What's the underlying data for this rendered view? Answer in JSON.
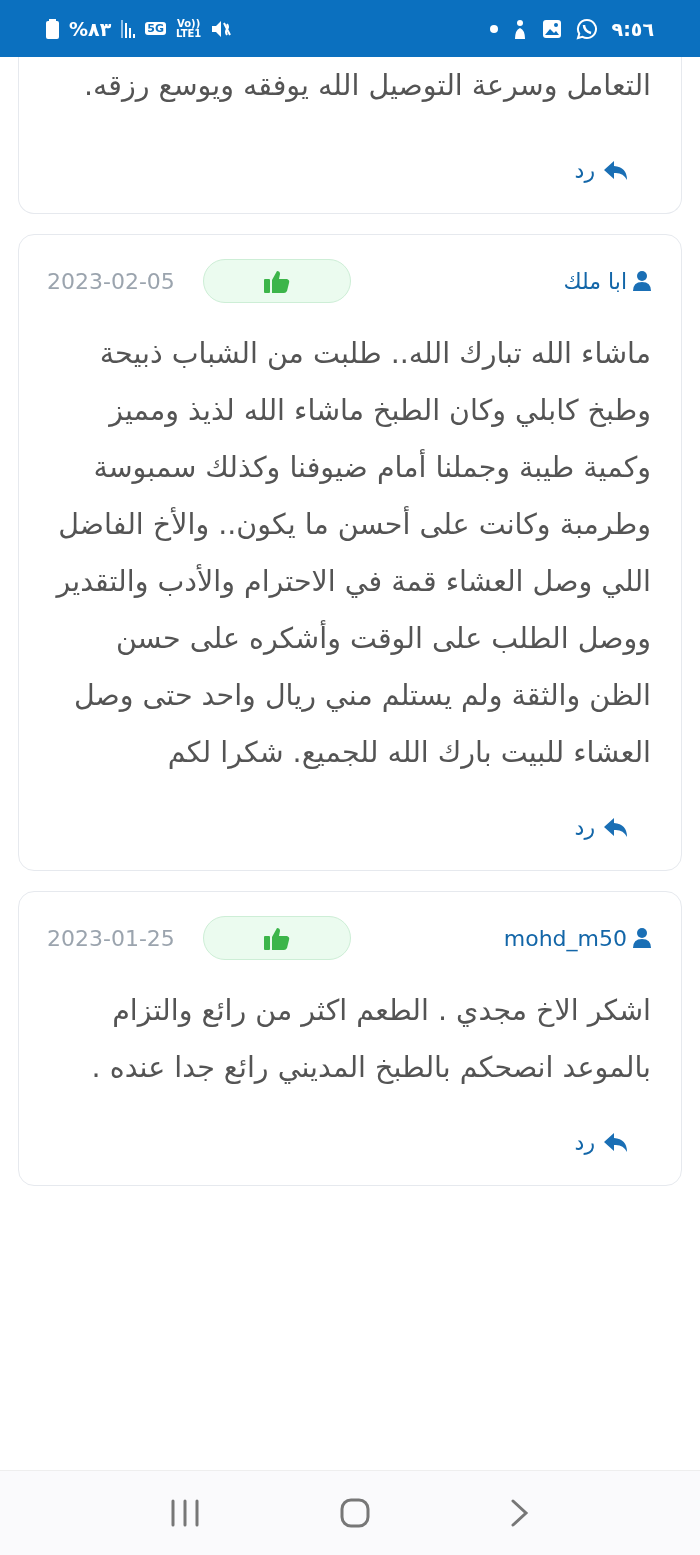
{
  "status_bar": {
    "time": "٩:٥٦",
    "battery": "%٨٣",
    "network": "5G",
    "volte": "Vo))",
    "volte_line": "LTE1"
  },
  "comments": [
    {
      "text": "التعامل وسرعة التوصيل الله يوفقه ويوسع رزقه.",
      "reply": "رد"
    },
    {
      "author": "ابا ملك",
      "date": "2023-02-05",
      "text": "ماشاء الله تبارك الله.. طلبت من الشباب ذبيحة وطبخ كابلي وكان الطبخ ماشاء الله لذيذ ومميز وكمية طيبة وجملنا أمام ضيوفنا وكذلك سمبوسة وطرمبة وكانت على أحسن ما يكون.. والأخ الفاضل اللي وصل العشاء قمة في الاحترام والأدب والتقدير ووصل الطلب على الوقت وأشكره على حسن الظن والثقة ولم يستلم مني ريال واحد حتى وصل العشاء للبيت بارك الله للجميع. شكرا لكم",
      "reply": "رد"
    },
    {
      "author": "mohd_m50",
      "date": "2023-01-25",
      "text": "اشكر الاخ مجدي . الطعم اكثر من رائع والتزام بالموعد انصحكم بالطبخ المديني رائع جدا عنده .",
      "reply": "رد"
    }
  ]
}
